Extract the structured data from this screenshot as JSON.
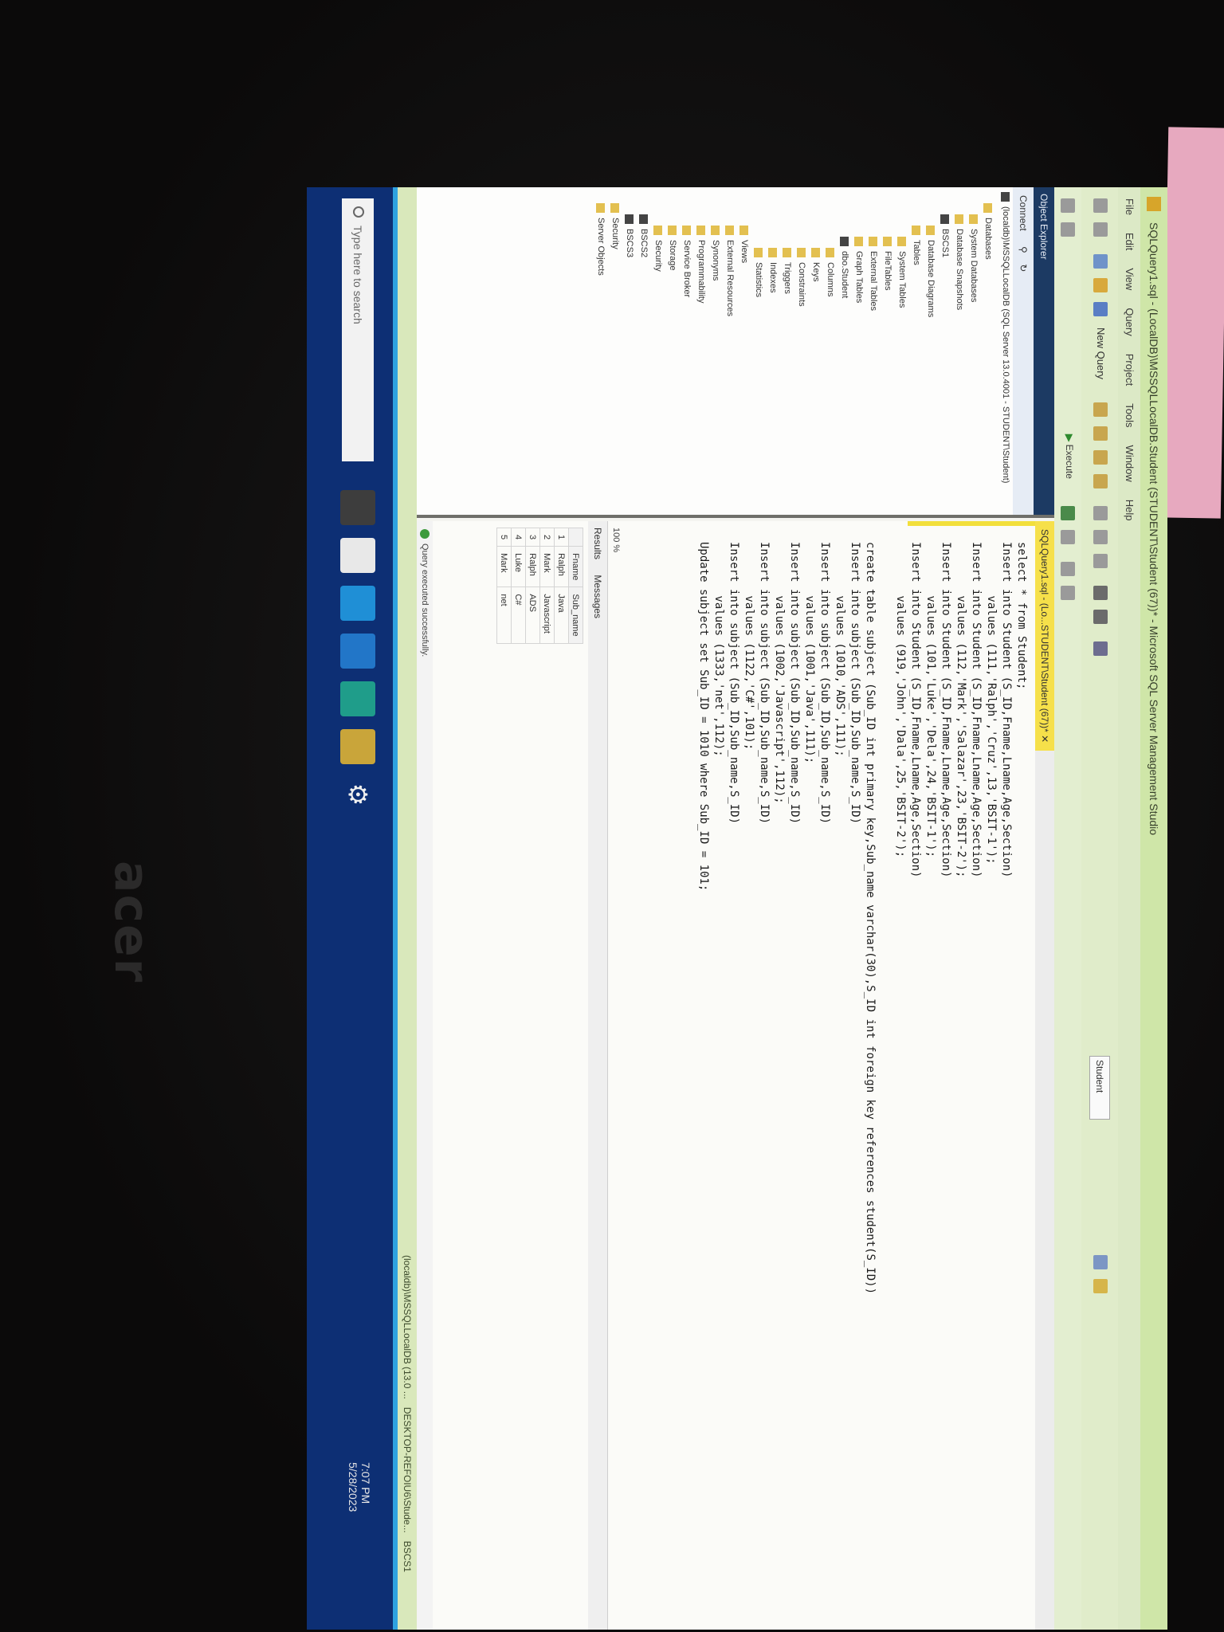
{
  "device": {
    "brand": "acer"
  },
  "window": {
    "title": "SQLQuery1.sql - (LocalDB)\\MSSQLLocalDB.Student (STUDENT\\Student (67))* - Microsoft SQL Server Management Studio",
    "menu": [
      "File",
      "Edit",
      "View",
      "Query",
      "Project",
      "Tools",
      "Window",
      "Help"
    ]
  },
  "toolbar": {
    "new_query_label": "New Query",
    "execute_label": "Execute",
    "database": "Student"
  },
  "object_explorer": {
    "title": "Object Explorer",
    "connect_label": "Connect",
    "server": "(localdb)\\MSSQLLocalDB (SQL Server 13.0.4001 - STUDENT\\Student)",
    "tree": [
      {
        "label": "Databases",
        "type": "folder",
        "indent": 1
      },
      {
        "label": "System Databases",
        "type": "folder",
        "indent": 2
      },
      {
        "label": "Database Snapshots",
        "type": "folder",
        "indent": 2
      },
      {
        "label": "BSCS1",
        "type": "db",
        "indent": 2
      },
      {
        "label": "Database Diagrams",
        "type": "folder",
        "indent": 3
      },
      {
        "label": "Tables",
        "type": "folder",
        "indent": 3
      },
      {
        "label": "System Tables",
        "type": "folder",
        "indent": 4
      },
      {
        "label": "FileTables",
        "type": "folder",
        "indent": 4
      },
      {
        "label": "External Tables",
        "type": "folder",
        "indent": 4
      },
      {
        "label": "Graph Tables",
        "type": "folder",
        "indent": 4
      },
      {
        "label": "dbo.Student",
        "type": "db",
        "indent": 4
      },
      {
        "label": "Columns",
        "type": "folder",
        "indent": 5
      },
      {
        "label": "Keys",
        "type": "folder",
        "indent": 5
      },
      {
        "label": "Constraints",
        "type": "folder",
        "indent": 5
      },
      {
        "label": "Triggers",
        "type": "folder",
        "indent": 5
      },
      {
        "label": "Indexes",
        "type": "folder",
        "indent": 5
      },
      {
        "label": "Statistics",
        "type": "folder",
        "indent": 5
      },
      {
        "label": "Views",
        "type": "folder",
        "indent": 3
      },
      {
        "label": "External Resources",
        "type": "folder",
        "indent": 3
      },
      {
        "label": "Synonyms",
        "type": "folder",
        "indent": 3
      },
      {
        "label": "Programmability",
        "type": "folder",
        "indent": 3
      },
      {
        "label": "Service Broker",
        "type": "folder",
        "indent": 3
      },
      {
        "label": "Storage",
        "type": "folder",
        "indent": 3
      },
      {
        "label": "Security",
        "type": "folder",
        "indent": 3
      },
      {
        "label": "BSCS2",
        "type": "db",
        "indent": 2
      },
      {
        "label": "BSCS3",
        "type": "db",
        "indent": 2
      },
      {
        "label": "Security",
        "type": "folder",
        "indent": 1
      },
      {
        "label": "Server Objects",
        "type": "folder",
        "indent": 1
      }
    ]
  },
  "editor": {
    "tab_label": "SQLQuery1.sql - (Lo...STUDENT\\Student (67))*",
    "lines": [
      "select * from Student;",
      "Insert into Student (S_ID,Fname,Lname,Age,Section)",
      "        values (111,'Ralph','Cruz',13,'BSIT-1');",
      "Insert into Student (S_ID,Fname,Lname,Age,Section)",
      "        values (112,'Mark','Salazar',23,'BSIT-2');",
      "Insert into Student (S_ID,Fname,Lname,Age,Section)",
      "        values (101,'Luke','Dela',24,'BSIT-1');",
      "Insert into Student (S_ID,Fname,Lname,Age,Section)",
      "        values (919,'John','Dala',25,'BSIT-2');",
      "",
      "create table subject (Sub_ID int primary key,Sub_name varchar(30),S_ID int foreign key references student(S_ID))",
      "Insert into subject (Sub_ID,Sub_name,S_ID)",
      "        values (1010,'ADS',111);",
      "Insert into subject (Sub_ID,Sub_name,S_ID)",
      "        values (1001,'Java',111);",
      "Insert into subject (Sub_ID,Sub_name,S_ID)",
      "        values (1002,'Javascript',112);",
      "Insert into subject (Sub_ID,Sub_name,S_ID)",
      "        values (1122,'C#',101);",
      "Insert into subject (Sub_ID,Sub_name,S_ID)",
      "        values (1333,'net',112);",
      "Update subject set Sub_ID = 1010 where Sub_ID = 101;"
    ],
    "zoom": "100 %"
  },
  "results": {
    "tabs": [
      "Results",
      "Messages"
    ],
    "columns": [
      "Fname",
      "Sub_name"
    ],
    "rows": [
      [
        "Ralph",
        "Java"
      ],
      [
        "Mark",
        "Javascript"
      ],
      [
        "Ralph",
        "ADS"
      ],
      [
        "Luke",
        "C#"
      ],
      [
        "Mark",
        "net"
      ]
    ],
    "status": "Query executed successfully."
  },
  "statusbar": {
    "server": "(localdb)\\MSSQLLocalDB (13.0 ...",
    "user": "DESKTOP-REFOIU6\\Stude...",
    "db": "BSCS1"
  },
  "taskbar": {
    "search_placeholder": "Type here to search",
    "time": "7:07 PM",
    "date": "5/28/2023"
  }
}
